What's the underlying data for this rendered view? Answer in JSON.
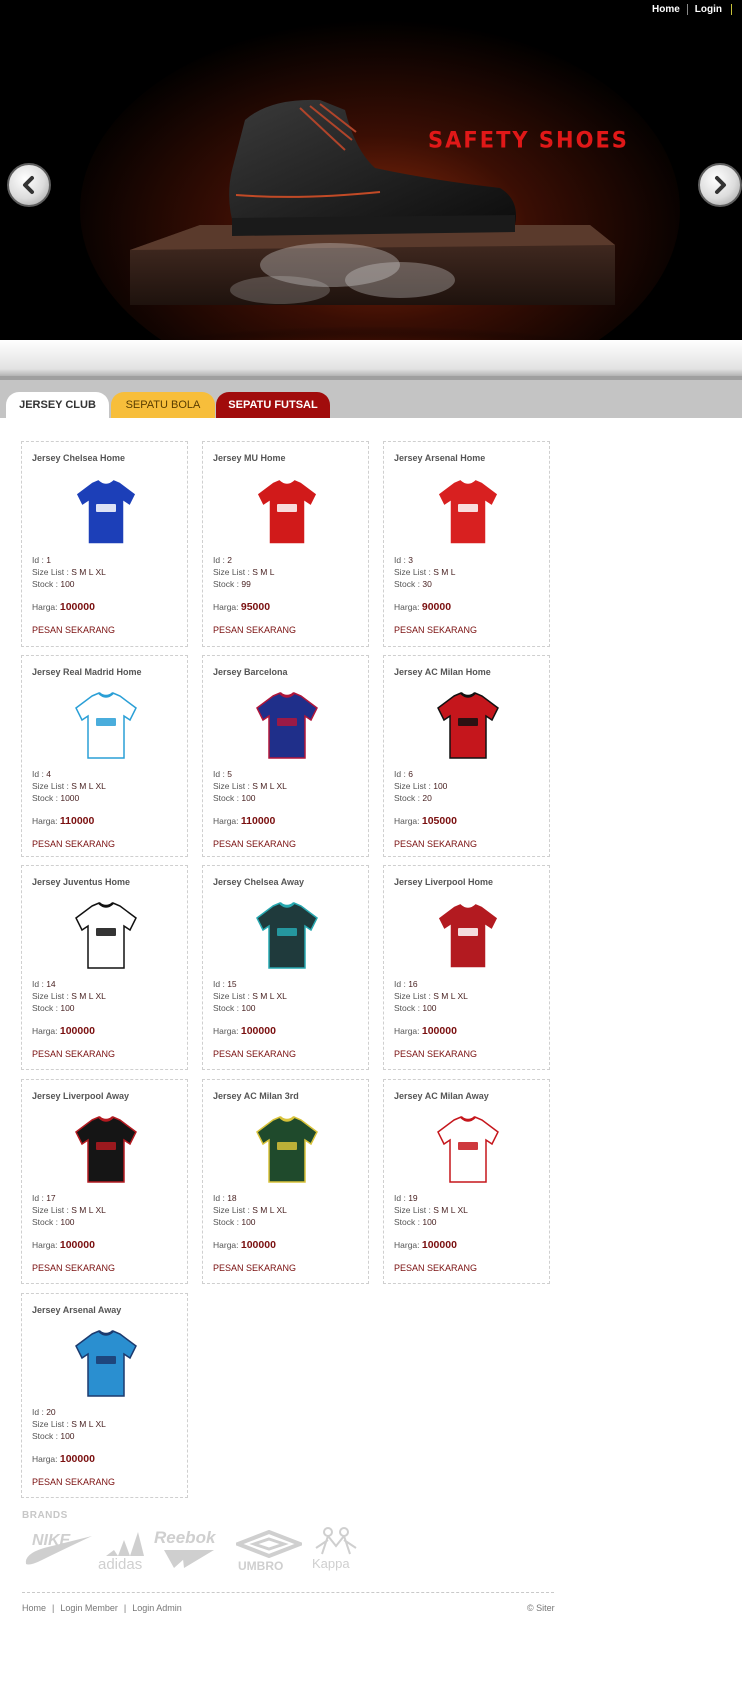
{
  "nav": {
    "home": "Home",
    "login": "Login"
  },
  "banner": {
    "title": "SAFETY SHOES"
  },
  "tabs": [
    {
      "label": "JERSEY CLUB",
      "active": true
    },
    {
      "label": "SEPATU BOLA",
      "active": false
    },
    {
      "label": "SEPATU FUTSAL",
      "active": false
    }
  ],
  "labels": {
    "id": "Id : ",
    "size": "Size List : ",
    "stock": "Stock : ",
    "price": "Harga: ",
    "order": "PESAN SEKARANG"
  },
  "products": [
    {
      "name": "Jersey Chelsea Home",
      "id": "1",
      "sizes": "S M L XL",
      "stock": "100",
      "price": "100000",
      "colors": [
        "#1c3fb8",
        "#ffffff"
      ]
    },
    {
      "name": "Jersey MU Home",
      "id": "2",
      "sizes": "S M L",
      "stock": "99",
      "price": "95000",
      "colors": [
        "#d11a1a",
        "#ffffff"
      ]
    },
    {
      "name": "Jersey Arsenal Home",
      "id": "3",
      "sizes": "S M L",
      "stock": "30",
      "price": "90000",
      "colors": [
        "#d82020",
        "#ffffff"
      ]
    },
    {
      "name": "Jersey Real Madrid Home",
      "id": "4",
      "sizes": "S M L XL",
      "stock": "1000",
      "price": "110000",
      "colors": [
        "#ffffff",
        "#2a9fd6"
      ]
    },
    {
      "name": "Jersey Barcelona",
      "id": "5",
      "sizes": "S M L XL",
      "stock": "100",
      "price": "110000",
      "colors": [
        "#1f2f8a",
        "#b0163a"
      ]
    },
    {
      "name": "Jersey AC Milan Home",
      "id": "6",
      "sizes": "100",
      "stock": "20",
      "price": "105000",
      "colors": [
        "#c5161c",
        "#111111"
      ]
    },
    {
      "name": "Jersey Juventus Home",
      "id": "14",
      "sizes": "S M L XL",
      "stock": "100",
      "price": "100000",
      "colors": [
        "#ffffff",
        "#111111"
      ]
    },
    {
      "name": "Jersey Chelsea Away",
      "id": "15",
      "sizes": "S M L XL",
      "stock": "100",
      "price": "100000",
      "colors": [
        "#1f3a3c",
        "#27a8b0"
      ]
    },
    {
      "name": "Jersey Liverpool Home",
      "id": "16",
      "sizes": "S M L XL",
      "stock": "100",
      "price": "100000",
      "colors": [
        "#b31a20",
        "#ffffff"
      ]
    },
    {
      "name": "Jersey Liverpool Away",
      "id": "17",
      "sizes": "S M L XL",
      "stock": "100",
      "price": "100000",
      "colors": [
        "#151515",
        "#b31a20"
      ]
    },
    {
      "name": "Jersey AC Milan 3rd",
      "id": "18",
      "sizes": "S M L XL",
      "stock": "100",
      "price": "100000",
      "colors": [
        "#1f4a2c",
        "#d8c23a"
      ]
    },
    {
      "name": "Jersey AC Milan Away",
      "id": "19",
      "sizes": "S M L XL",
      "stock": "100",
      "price": "100000",
      "colors": [
        "#ffffff",
        "#c5161c"
      ]
    },
    {
      "name": "Jersey Arsenal Away",
      "id": "20",
      "sizes": "S M L XL",
      "stock": "100",
      "price": "100000",
      "colors": [
        "#2a8fd0",
        "#1c3a6e"
      ]
    }
  ],
  "brands": {
    "title": "BRANDS",
    "items": [
      "NIKE",
      "adidas",
      "Reebok",
      "UMBRO",
      "Kappa"
    ]
  },
  "footer": {
    "links": [
      "Home",
      "Login Member",
      "Login Admin"
    ],
    "copyright": "© Siter"
  }
}
